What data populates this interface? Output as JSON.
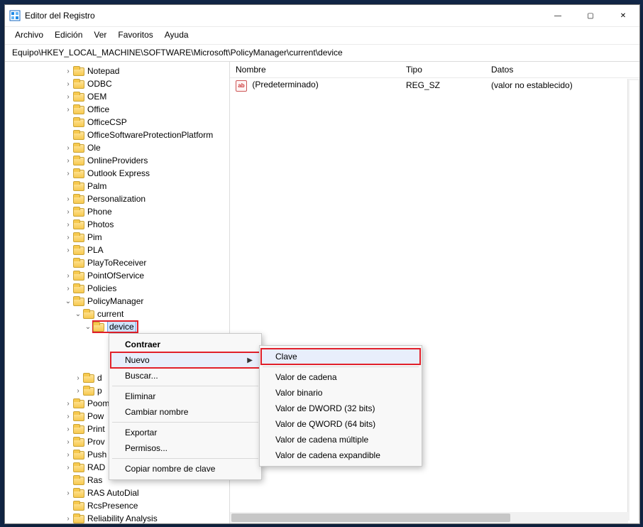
{
  "window": {
    "title": "Editor del Registro",
    "min": "—",
    "max": "▢",
    "close": "✕"
  },
  "menubar": [
    "Archivo",
    "Edición",
    "Ver",
    "Favoritos",
    "Ayuda"
  ],
  "address": "Equipo\\HKEY_LOCAL_MACHINE\\SOFTWARE\\Microsoft\\PolicyManager\\current\\device",
  "tree": {
    "visible_nodes": [
      {
        "indent": 7,
        "twisty": ">",
        "label": "Notepad"
      },
      {
        "indent": 7,
        "twisty": ">",
        "label": "ODBC"
      },
      {
        "indent": 7,
        "twisty": ">",
        "label": "OEM"
      },
      {
        "indent": 7,
        "twisty": ">",
        "label": "Office"
      },
      {
        "indent": 7,
        "twisty": "",
        "label": "OfficeCSP"
      },
      {
        "indent": 7,
        "twisty": "",
        "label": "OfficeSoftwareProtectionPlatform"
      },
      {
        "indent": 7,
        "twisty": ">",
        "label": "Ole"
      },
      {
        "indent": 7,
        "twisty": ">",
        "label": "OnlineProviders"
      },
      {
        "indent": 7,
        "twisty": ">",
        "label": "Outlook Express"
      },
      {
        "indent": 7,
        "twisty": "",
        "label": "Palm"
      },
      {
        "indent": 7,
        "twisty": ">",
        "label": "Personalization"
      },
      {
        "indent": 7,
        "twisty": ">",
        "label": "Phone"
      },
      {
        "indent": 7,
        "twisty": ">",
        "label": "Photos"
      },
      {
        "indent": 7,
        "twisty": ">",
        "label": "Pim"
      },
      {
        "indent": 7,
        "twisty": ">",
        "label": "PLA"
      },
      {
        "indent": 7,
        "twisty": "",
        "label": "PlayToReceiver"
      },
      {
        "indent": 7,
        "twisty": ">",
        "label": "PointOfService"
      },
      {
        "indent": 7,
        "twisty": ">",
        "label": "Policies"
      },
      {
        "indent": 7,
        "twisty": "v",
        "label": "PolicyManager"
      },
      {
        "indent": 8,
        "twisty": "v",
        "label": "current"
      },
      {
        "indent": 9,
        "twisty": "v",
        "label": "device",
        "selected": true,
        "red": true
      },
      {
        "indent": 10,
        "twisty": "",
        "label": ""
      },
      {
        "indent": 10,
        "twisty": "",
        "label": ""
      },
      {
        "indent": 10,
        "twisty": "",
        "label": ""
      },
      {
        "indent": 8,
        "twisty": ">",
        "label": "d"
      },
      {
        "indent": 8,
        "twisty": ">",
        "label": "p"
      },
      {
        "indent": 7,
        "twisty": ">",
        "label": "Poom"
      },
      {
        "indent": 7,
        "twisty": ">",
        "label": "Pow"
      },
      {
        "indent": 7,
        "twisty": ">",
        "label": "Print"
      },
      {
        "indent": 7,
        "twisty": ">",
        "label": "Prov"
      },
      {
        "indent": 7,
        "twisty": ">",
        "label": "Push"
      },
      {
        "indent": 7,
        "twisty": ">",
        "label": "RAD"
      },
      {
        "indent": 7,
        "twisty": "",
        "label": "Ras"
      },
      {
        "indent": 7,
        "twisty": ">",
        "label": "RAS AutoDial"
      },
      {
        "indent": 7,
        "twisty": "",
        "label": "RcsPresence"
      },
      {
        "indent": 7,
        "twisty": ">",
        "label": "Reliability Analysis"
      }
    ]
  },
  "list": {
    "headers": [
      "Nombre",
      "Tipo",
      "Datos"
    ],
    "rows": [
      {
        "name": "(Predeterminado)",
        "type": "REG_SZ",
        "data": "(valor no establecido)"
      }
    ]
  },
  "context_menu": {
    "items": [
      {
        "label": "Contraer",
        "bold": true
      },
      {
        "label": "Nuevo",
        "submenu": true,
        "hover": true,
        "red": true
      },
      {
        "label": "Buscar..."
      },
      {
        "sep": true
      },
      {
        "label": "Eliminar"
      },
      {
        "label": "Cambiar nombre"
      },
      {
        "sep": true
      },
      {
        "label": "Exportar"
      },
      {
        "label": "Permisos..."
      },
      {
        "sep": true
      },
      {
        "label": "Copiar nombre de clave"
      }
    ]
  },
  "submenu": {
    "items": [
      {
        "label": "Clave",
        "red": true,
        "hover": true
      },
      {
        "sep": true
      },
      {
        "label": "Valor de cadena"
      },
      {
        "label": "Valor binario"
      },
      {
        "label": "Valor de DWORD (32 bits)"
      },
      {
        "label": "Valor de QWORD (64 bits)"
      },
      {
        "label": "Valor de cadena múltiple"
      },
      {
        "label": "Valor de cadena expandible"
      }
    ]
  }
}
